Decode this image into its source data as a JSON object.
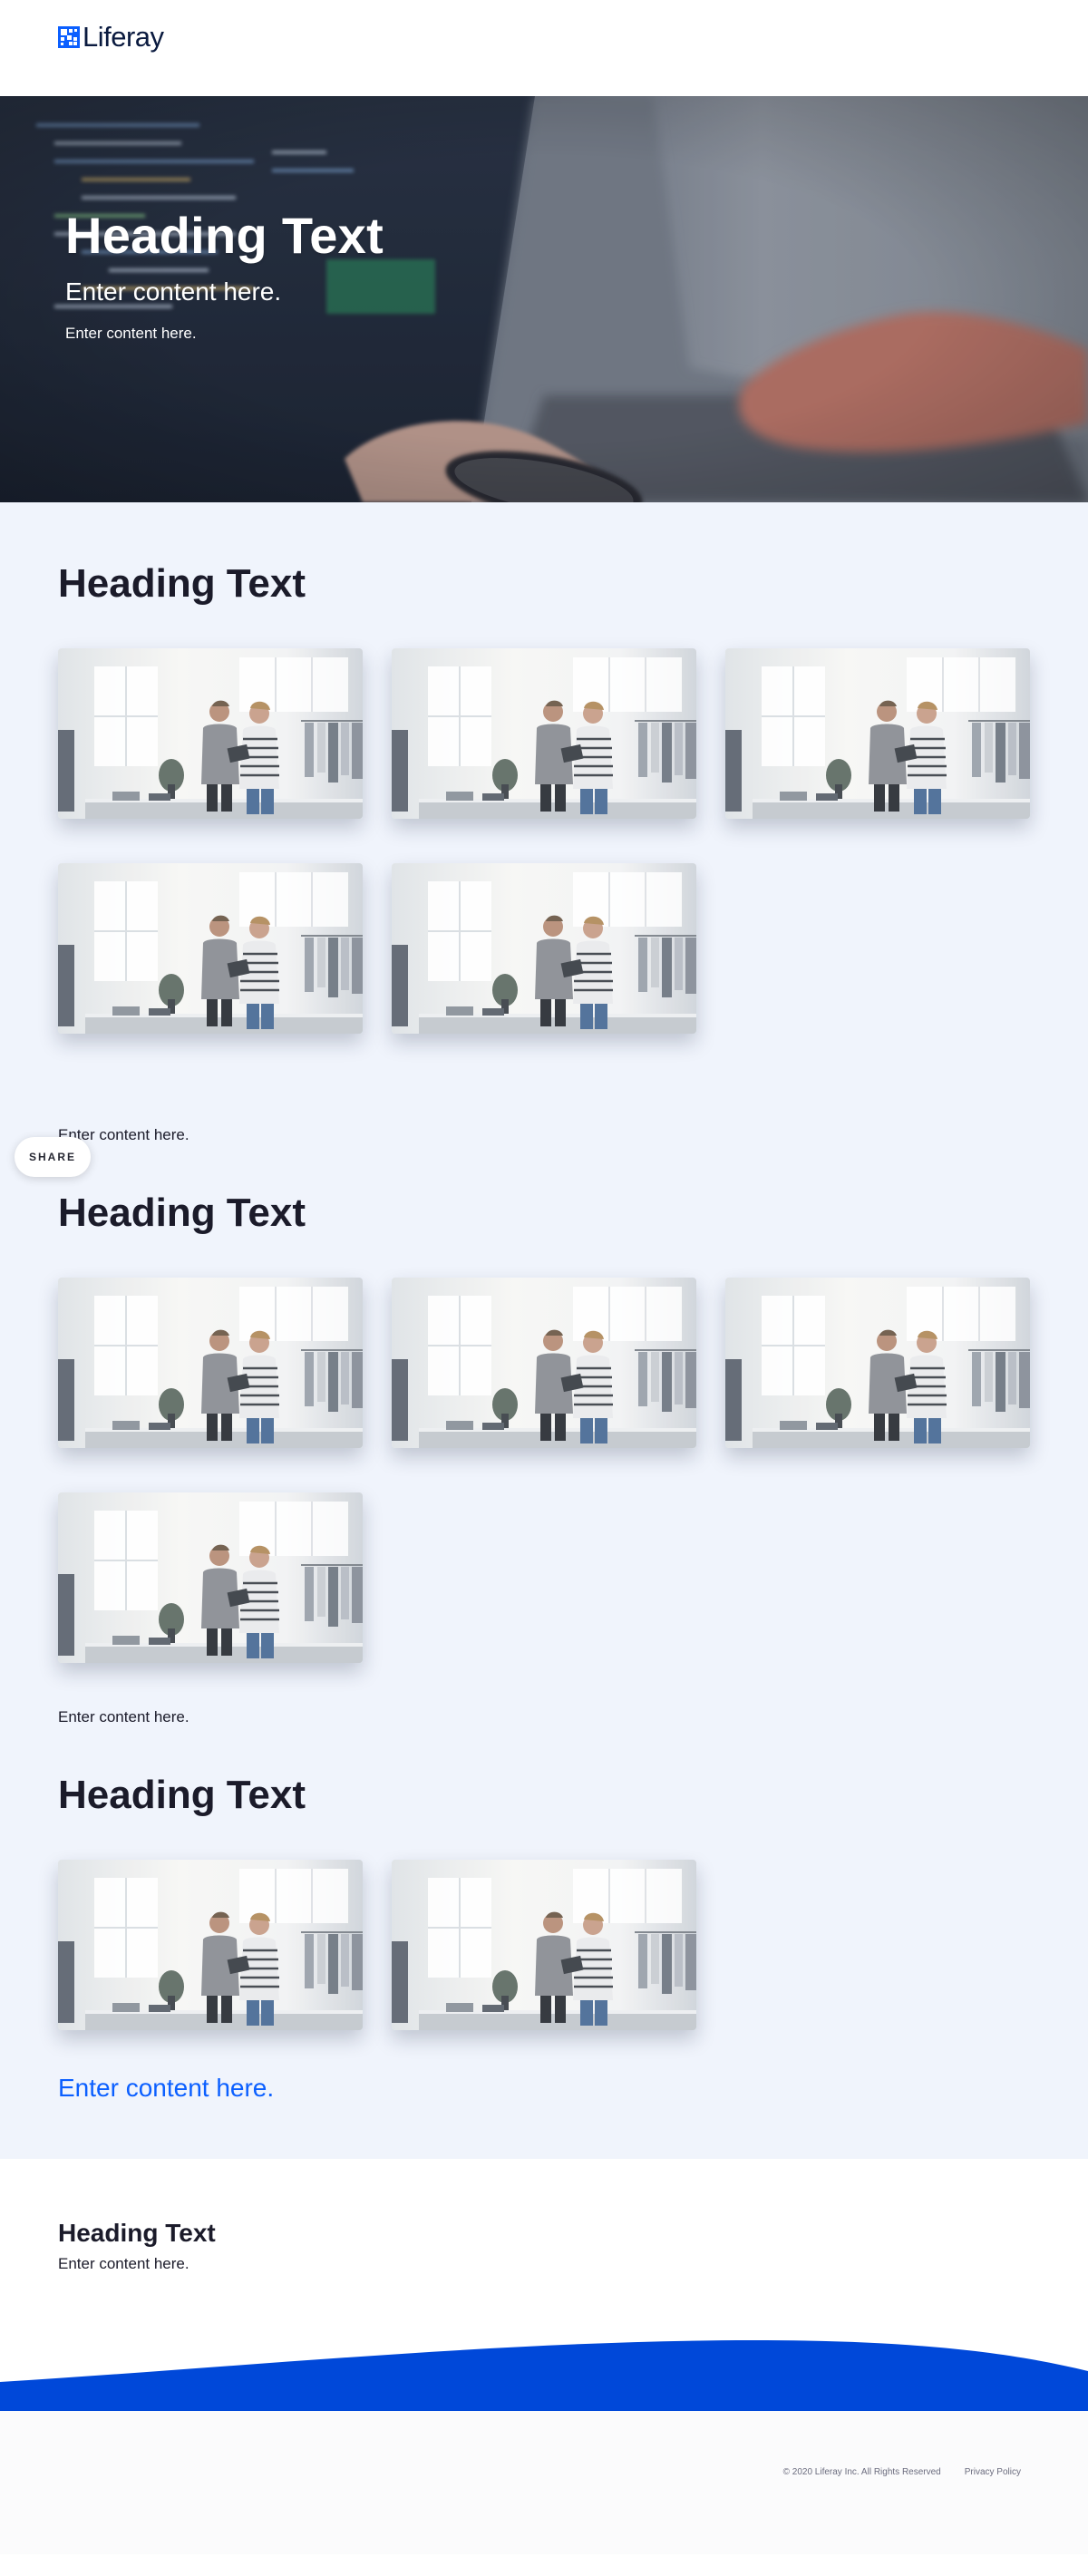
{
  "header": {
    "logo_text": "Liferay",
    "brand_color": "#0b5fff",
    "logo_icon": "liferay-logo-icon"
  },
  "hero": {
    "title": "Heading Text",
    "subtitle": "Enter content here.",
    "small_text": "Enter content here.",
    "background": "laptop-typing-photo"
  },
  "share": {
    "label": "SHARE"
  },
  "sections": [
    {
      "heading": "Heading Text",
      "image_count": 5,
      "image_subject": "two-people-in-studio-photo",
      "text": "Enter content here."
    },
    {
      "heading": "Heading Text",
      "image_count": 4,
      "image_subject": "two-people-in-studio-photo",
      "text": "Enter content here."
    },
    {
      "heading": "Heading Text",
      "image_count": 2,
      "image_subject": "two-people-in-studio-photo",
      "link": "Enter content here."
    }
  ],
  "info": {
    "heading": "Heading Text",
    "text": "Enter content here."
  },
  "footer": {
    "copyright": "© 2020 Liferay Inc. All Rights Reserved",
    "privacy_label": "Privacy Policy",
    "wave_color": "#0048d9"
  }
}
